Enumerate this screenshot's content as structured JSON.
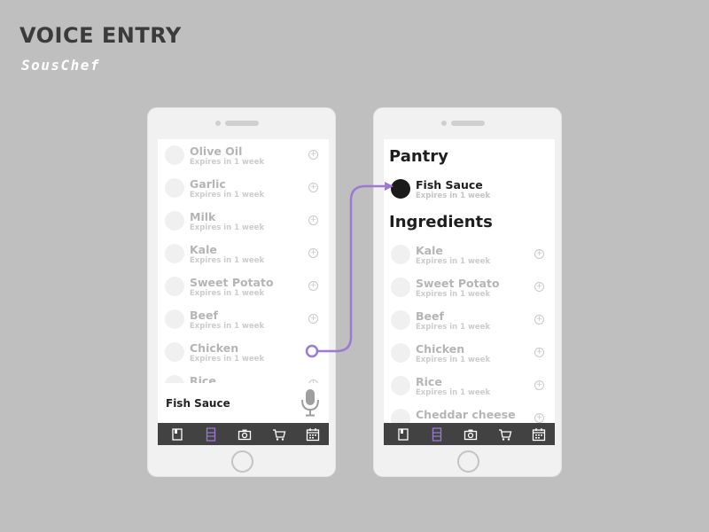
{
  "page": {
    "title": "VOICE ENTRY",
    "brand": "SousChef"
  },
  "left_phone": {
    "items": [
      {
        "name": "Olive Oil",
        "expiry": "Expires in 1 week"
      },
      {
        "name": "Garlic",
        "expiry": "Expires in 1 week"
      },
      {
        "name": "Milk",
        "expiry": "Expires in 1 week"
      },
      {
        "name": "Kale",
        "expiry": "Expires in 1 week"
      },
      {
        "name": "Sweet Potato",
        "expiry": "Expires in 1 week"
      },
      {
        "name": "Beef",
        "expiry": "Expires in 1 week"
      },
      {
        "name": "Chicken",
        "expiry": "Expires in 1 week"
      },
      {
        "name": "Rice",
        "expiry": ""
      }
    ],
    "voice_text": "Fish Sauce"
  },
  "right_phone": {
    "pantry_heading": "Pantry",
    "pantry_item": {
      "name": "Fish Sauce",
      "expiry": "Expires in 1 week"
    },
    "ingredients_heading": "Ingredients",
    "items": [
      {
        "name": "Kale",
        "expiry": "Expires in 1 week"
      },
      {
        "name": "Sweet Potato",
        "expiry": "Expires in 1 week"
      },
      {
        "name": "Beef",
        "expiry": "Expires in 1 week"
      },
      {
        "name": "Chicken",
        "expiry": "Expires in 1 week"
      },
      {
        "name": "Rice",
        "expiry": "Expires in 1 week"
      },
      {
        "name": "Cheddar cheese",
        "expiry": ""
      }
    ]
  },
  "tabs": [
    {
      "icon": "book-icon",
      "active": false
    },
    {
      "icon": "fridge-icon",
      "active": true
    },
    {
      "icon": "camera-icon",
      "active": false
    },
    {
      "icon": "cart-icon",
      "active": false
    },
    {
      "icon": "calendar-icon",
      "active": false
    }
  ],
  "colors": {
    "accent": "#9c79d2",
    "tabbar": "#424242",
    "background": "#bfbfbf"
  }
}
